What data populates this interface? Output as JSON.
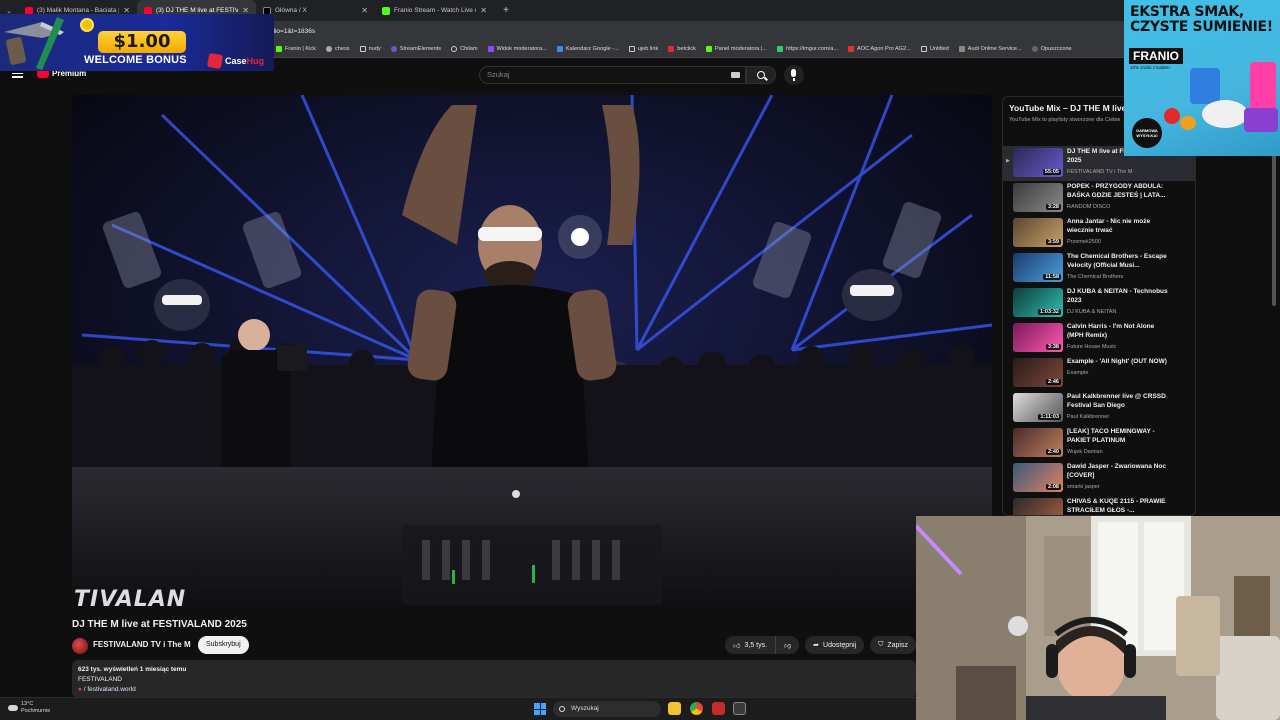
{
  "browser": {
    "tabs": [
      {
        "title": "(3) Malik Montana - Baciata [Of...",
        "icon": "youtube-icon",
        "active": false
      },
      {
        "title": "(3) DJ THE M live at FESTIVALAN...",
        "icon": "youtube-icon",
        "active": true
      },
      {
        "title": "Główna / X",
        "icon": "x-icon",
        "active": false
      },
      {
        "title": "Franio Stream - Watch Live on K...",
        "icon": "kick-icon",
        "active": false
      }
    ],
    "url_fragment": "rt_radio=1&t=1836s",
    "bookmarks": [
      "Franio | Kick",
      "chess",
      "nudy",
      "StreamElements",
      "Chilam",
      "Widok moderatora...",
      "Kalendarz Google -...",
      "ujeb link",
      "betclick",
      "Panel moderatora |...",
      "https://imgur.com/a...",
      "AOC Agon Pro AG2...",
      "Untitled",
      "Audi Online Service...",
      "Opuszczone"
    ]
  },
  "promo": {
    "amount": "$1.00",
    "text": "WELCOME BONUS",
    "brand_a": "Case",
    "brand_b": "Hug"
  },
  "header": {
    "logo_text": "Premium",
    "search_placeholder": "Szukaj"
  },
  "video": {
    "title": "DJ THE M live at FESTIVALAND 2025",
    "watermark": "TIVALAN",
    "channel": "FESTIVALAND TV i The M",
    "subscribe": "Subskrybuj",
    "likes": "3,5 tys.",
    "share": "Udostępnij",
    "save": "Zapisz",
    "views_date": "623 tys. wyświetleń  1 miesiąc temu",
    "desc_line": "FESTIVALAND",
    "desc_link": "/ festivaland.world"
  },
  "playlist": {
    "title": "YouTube Mix – DJ THE M live at FESTIVALAND 2025",
    "subtitle": "YouTube Mix to playlisty stworzone dla Ciebie",
    "items": [
      {
        "title": "DJ THE M live at FESTIVALAND 2025",
        "channel": "FESTIVALAND TV i The M",
        "duration": "55:05",
        "current": true,
        "colors": [
          "#2a2a55",
          "#6a5acd"
        ]
      },
      {
        "title": "POPEK - PRZYGODY ABDULA: BAŚKA GDZIE JESTEŚ | LATA...",
        "channel": "RANDOM DISCO",
        "duration": "3:28",
        "current": false,
        "colors": [
          "#3b3b3b",
          "#8a8a8a"
        ]
      },
      {
        "title": "Anna Jantar - Nic nie może wiecznie trwać",
        "channel": "Przemek2500",
        "duration": "3:59",
        "current": false,
        "colors": [
          "#5a4630",
          "#c9a26a"
        ]
      },
      {
        "title": "The Chemical Brothers - Escape Velocity (Official Musi...",
        "channel": "The Chemical Brothers",
        "duration": "11:58",
        "current": false,
        "colors": [
          "#1a3a6a",
          "#4aa0e0"
        ]
      },
      {
        "title": "DJ KUBA & NEITAN - Technobus 2023",
        "channel": "DJ KUBA & NEITAN",
        "duration": "1:03:32",
        "current": false,
        "colors": [
          "#0f3a3a",
          "#2fc0b0"
        ]
      },
      {
        "title": "Calvin Harris - I'm Not Alone (MPH Remix)",
        "channel": "Future House Music",
        "duration": "3:38",
        "current": false,
        "colors": [
          "#7a1a5a",
          "#ff5ab0"
        ]
      },
      {
        "title": "Example - 'All Night' (OUT NOW)",
        "channel": "Example",
        "duration": "2:46",
        "current": false,
        "colors": [
          "#2a1a1a",
          "#7a4a3a"
        ]
      },
      {
        "title": "Paul Kalkbrenner live @ CRSSD Festival San Diego",
        "channel": "Paul Kalkbrenner",
        "duration": "1:11:03",
        "current": false,
        "colors": [
          "#dddddd",
          "#555555"
        ]
      },
      {
        "title": "[LEAK] TACO HEMINGWAY - PAKIET PLATINUM",
        "channel": "Wujek Damian",
        "duration": "2:40",
        "current": false,
        "colors": [
          "#4a2a2a",
          "#c08060"
        ]
      },
      {
        "title": "Dawid Jasper - Zwariowana Noc [COVER]",
        "channel": "smarki jasper",
        "duration": "2:08",
        "current": false,
        "colors": [
          "#3a5a7a",
          "#e08060"
        ]
      },
      {
        "title": "CHIVAS & KUQE 2115 - PRAWIE STRACIŁEM GŁOS -...",
        "channel": "",
        "duration": "",
        "current": false,
        "colors": [
          "#2a2a2a",
          "#aa6040"
        ]
      }
    ]
  },
  "ad": {
    "headline_1": "EKSTRA SMAK,",
    "headline_2": "CZYSTE SUMIENIE!",
    "brand": "FRANIO",
    "brand_sub": "10% zniżki z kodem",
    "badge": "DARMOWA WYSYŁKA!"
  },
  "taskbar": {
    "temp": "13°C",
    "weather": "Pochmurnie",
    "search": "Wyszukaj"
  }
}
